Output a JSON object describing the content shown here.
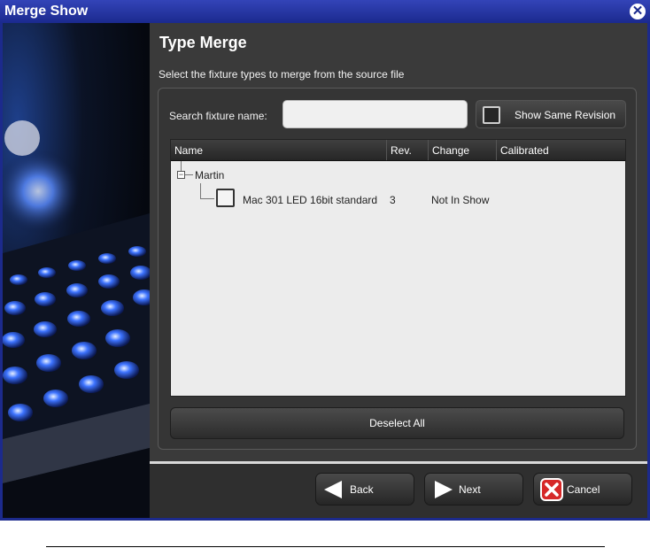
{
  "window": {
    "title": "Merge Show"
  },
  "page": {
    "heading": "Type Merge",
    "subheading": "Select the fixture types to merge from the source file"
  },
  "search": {
    "label": "Search fixture name:",
    "value": "",
    "placeholder": ""
  },
  "same_revision": {
    "label": "Show Same Revision",
    "checked": false
  },
  "table": {
    "columns": [
      "Name",
      "Rev.",
      "Change",
      "Calibrated"
    ],
    "tree": {
      "group_label": "Martin",
      "group_toggle": "−",
      "items": [
        {
          "name": "Mac 301 LED 16bit standard",
          "rev": "3",
          "change": "Not In Show",
          "calibrated": "",
          "checked": false
        }
      ]
    }
  },
  "buttons": {
    "deselect_all": "Deselect All",
    "back": "Back",
    "next": "Next",
    "cancel": "Cancel"
  },
  "icons": {
    "close": "close-icon",
    "back": "arrow-left-icon",
    "next": "arrow-right-icon",
    "cancel": "cancel-x-icon"
  },
  "colors": {
    "title_bar": "#1b2a8e",
    "panel": "#3a3a3a",
    "cancel_icon": "#d62828"
  }
}
